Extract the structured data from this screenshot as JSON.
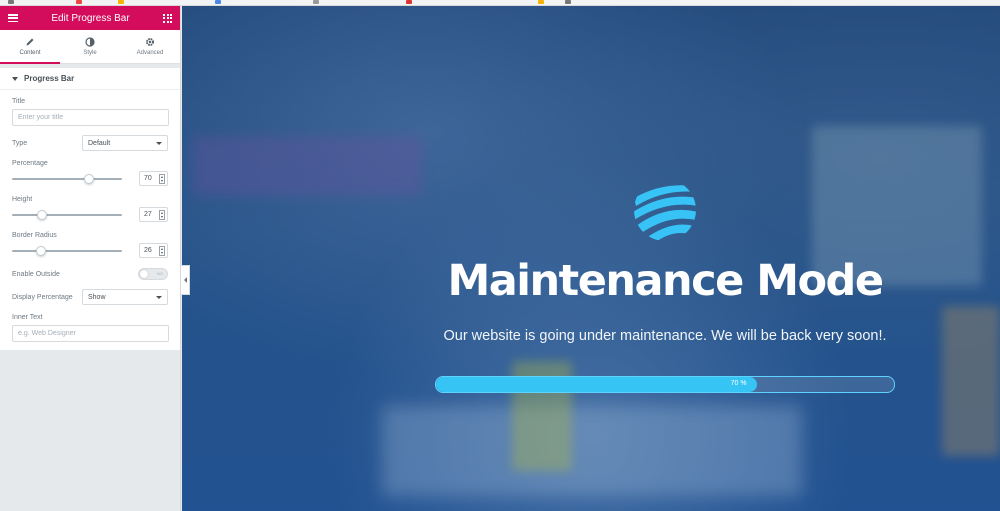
{
  "panel": {
    "header_title": "Edit Progress Bar",
    "tabs": [
      {
        "label": "Content",
        "icon": "pencil-icon"
      },
      {
        "label": "Style",
        "icon": "half-circle-icon"
      },
      {
        "label": "Advanced",
        "icon": "gear-icon"
      }
    ],
    "section_title": "Progress Bar",
    "title_label": "Title",
    "title_placeholder": "Enter your title",
    "type_label": "Type",
    "type_value": "Default",
    "percentage_label": "Percentage",
    "percentage_value": "70",
    "percentage_level": 0.7,
    "height_label": "Height",
    "height_value": "27",
    "height_level": 0.27,
    "border_radius_label": "Border Radius",
    "border_radius_value": "26",
    "border_radius_level": 0.26,
    "enable_outside_label": "Enable Outside",
    "enable_outside_state": "NO",
    "display_percentage_label": "Display Percentage",
    "display_percentage_value": "Show",
    "inner_text_label": "Inner Text",
    "inner_text_placeholder": "e.g. Web Designer"
  },
  "preview": {
    "heading": "Maintenance Mode",
    "subtext": "Our website is going under maintenance. We will be back very soon!.",
    "progress_label": "70 %",
    "progress_fraction": 0.7,
    "accent_color": "#36c4f4"
  },
  "colors": {
    "brand": "#d30c5c",
    "panel_text": "#6d7882"
  }
}
